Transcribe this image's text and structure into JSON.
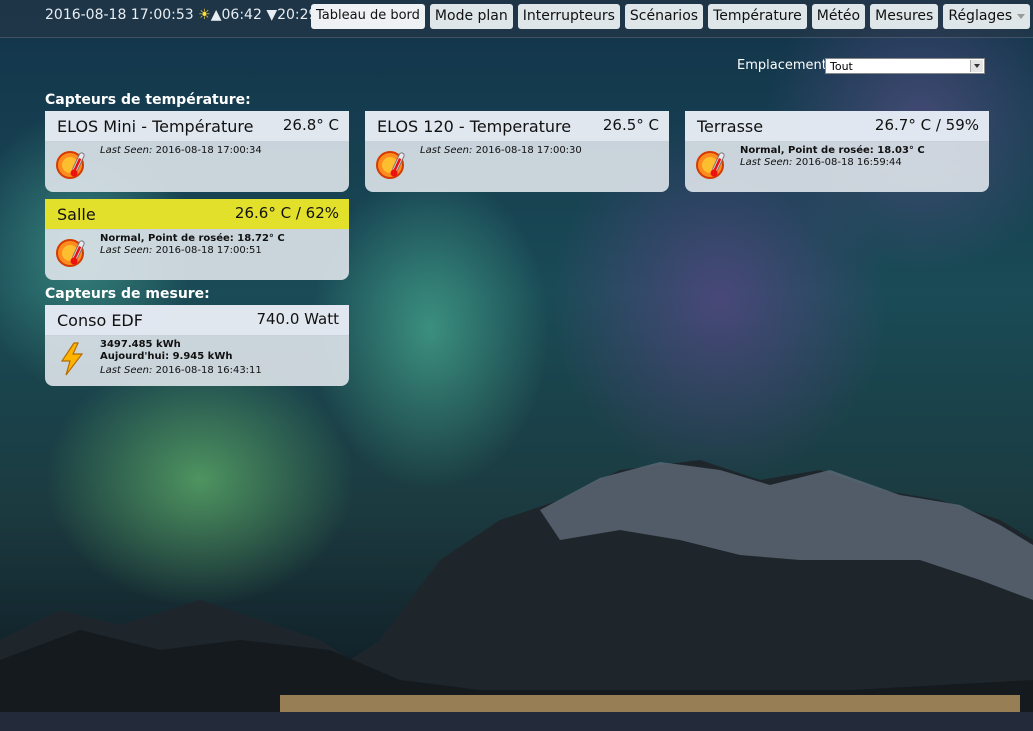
{
  "topbar": {
    "date": "2016-08-18 17:00:53",
    "sunrise": "06:42",
    "sunset": "20:29",
    "tabs": [
      {
        "label": "Tableau de bord"
      },
      {
        "label": "Mode plan"
      },
      {
        "label": "Interrupteurs"
      },
      {
        "label": "Scénarios"
      },
      {
        "label": "Température"
      },
      {
        "label": "Météo"
      },
      {
        "label": "Mesures"
      },
      {
        "label": "Réglages"
      }
    ]
  },
  "location": {
    "label": "Emplacement:",
    "selected": "Tout"
  },
  "sections": {
    "temperature": "Capteurs de température:",
    "measure": "Capteurs de mesure:"
  },
  "cards": [
    {
      "name": "ELOS Mini - Température",
      "value": "26.8° C",
      "status": "",
      "last_seen_label": "Last Seen:",
      "last_seen": "2016-08-18 17:00:34",
      "icon": "thermometer-sun-icon"
    },
    {
      "name": "ELOS 120 - Temperature",
      "value": "26.5° C",
      "status": "",
      "last_seen_label": "Last Seen:",
      "last_seen": "2016-08-18 17:00:30",
      "icon": "thermometer-sun-icon"
    },
    {
      "name": "Terrasse",
      "value": "26.7° C / 59%",
      "status": "Normal, Point de rosée: 18.03° C",
      "last_seen_label": "Last Seen:",
      "last_seen": "2016-08-18 16:59:44",
      "icon": "thermometer-sun-icon"
    },
    {
      "name": "Salle",
      "value": "26.6° C / 62%",
      "status": "Normal, Point de rosée: 18.72° C",
      "last_seen_label": "Last Seen:",
      "last_seen": "2016-08-18 17:00:51",
      "icon": "thermometer-sun-icon",
      "highlight": "#e2e02a"
    },
    {
      "name": "Conso EDF",
      "value": "740.0 Watt",
      "line1": "3497.485 kWh",
      "line2": "Aujourd'hui: 9.945 kWh",
      "last_seen_label": "Last Seen:",
      "last_seen": "2016-08-18 16:43:11",
      "icon": "lightning-bolt-icon"
    }
  ]
}
